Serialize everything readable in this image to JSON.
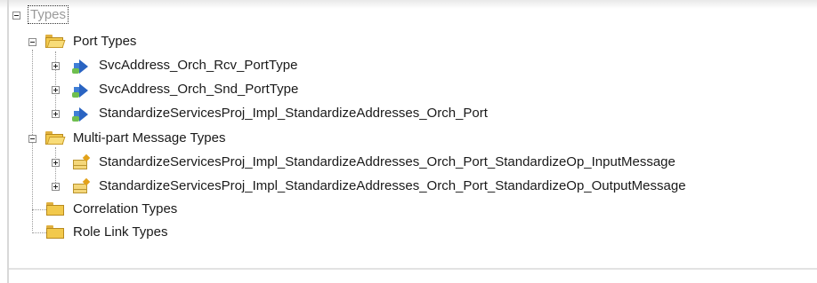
{
  "tree": {
    "root": {
      "label": "Types"
    },
    "nodes": [
      {
        "label": "Port Types"
      },
      {
        "label": "SvcAddress_Orch_Rcv_PortType"
      },
      {
        "label": "SvcAddress_Orch_Snd_PortType"
      },
      {
        "label": "StandardizeServicesProj_Impl_StandardizeAddresses_Orch_Port"
      },
      {
        "label": "Multi-part Message Types"
      },
      {
        "label": "StandardizeServicesProj_Impl_StandardizeAddresses_Orch_Port_StandardizeOp_InputMessage"
      },
      {
        "label": "StandardizeServicesProj_Impl_StandardizeAddresses_Orch_Port_StandardizeOp_OutputMessage"
      },
      {
        "label": "Correlation Types"
      },
      {
        "label": "Role Link Types"
      }
    ]
  },
  "icons": {
    "folder": "folder-icon",
    "folder_open": "folder-open-icon",
    "port_type": "port-type-icon",
    "message_type": "message-type-icon",
    "expand": "expand-icon",
    "collapse": "collapse-icon"
  },
  "colors": {
    "folder": "#f2c94c",
    "port": "#2a64c2",
    "message": "#f4d77a"
  }
}
